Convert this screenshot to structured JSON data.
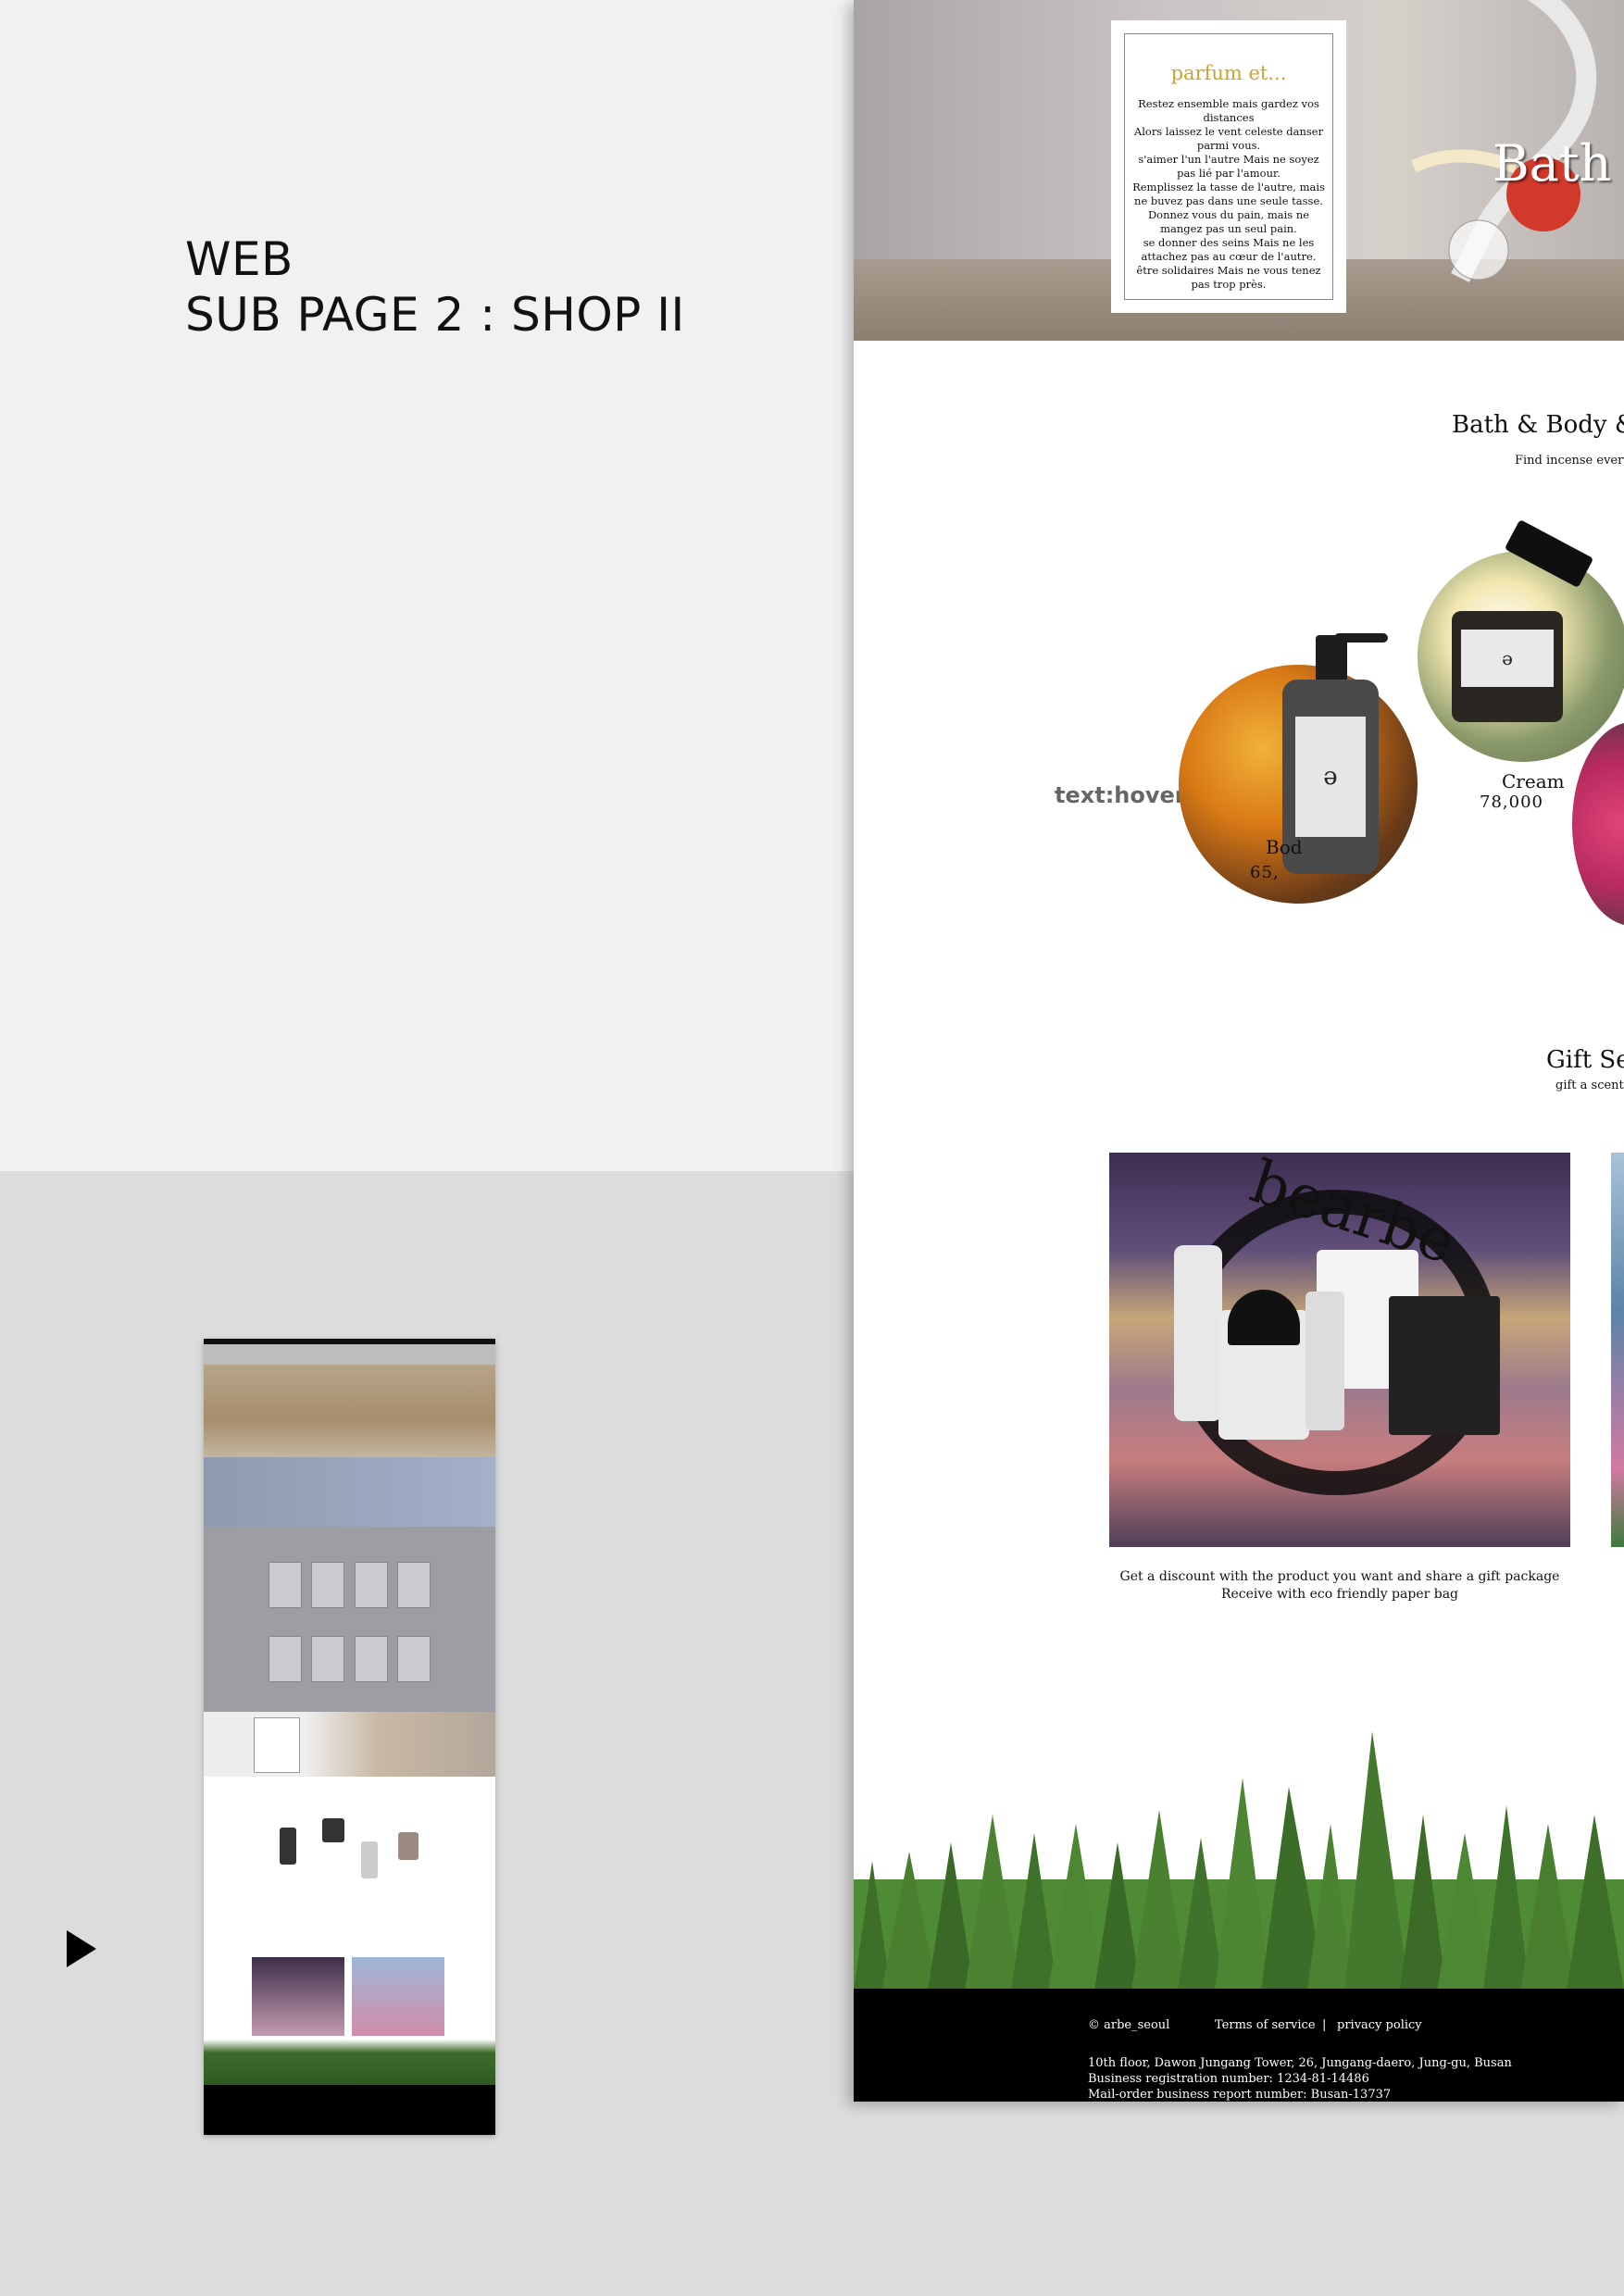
{
  "heading": {
    "line1": "WEB",
    "line2": "SUB PAGE 2 : SHOP II"
  },
  "banner": {
    "title": "Bath &"
  },
  "poem": {
    "title": "parfum et...",
    "text": "Restez ensemble mais gardez vos distances\nAlors laissez le vent celeste danser parmi vous.\ns'aimer l'un l'autre Mais ne soyez pas lié par l'amour.\nRemplissez la tasse de l'autre, mais ne buvez pas dans une seule tasse.\nDonnez vous du pain, mais ne mangez pas un seul pain.\nse donner des seins Mais ne les attachez pas au cœur de l'autre.\nêtre solidaires Mais ne vous tenez pas trop près."
  },
  "category": {
    "title": "Bath & Body &",
    "subtitle": "Find incense every"
  },
  "hover_label": "text:hover",
  "products": [
    {
      "name": "Bod",
      "price": "65,"
    },
    {
      "name": "Cream",
      "price": "78,000"
    }
  ],
  "gift": {
    "title": "Gift Se",
    "subtitle": "gift a scent",
    "image_text": "bearbe",
    "description": "Get a discount with the product you want and share a gift package\nReceive with eco friendly paper bag"
  },
  "footer": {
    "copyright": "© arbe_seoul",
    "terms": "Terms of service",
    "separator": "|",
    "privacy": "privacy policy",
    "info": "10th floor, Dawon Jungang Tower, 26, Jungang-daero, Jung-gu, Busan\nBusiness registration number: 1234-81-14486\nMail-order business report number: Busan-13737"
  },
  "colors": {
    "accent_gold": "#d2a12a",
    "footer_bg": "#000000",
    "hover_label": "#666666"
  },
  "icons": {
    "play": "play-triangle-icon"
  }
}
